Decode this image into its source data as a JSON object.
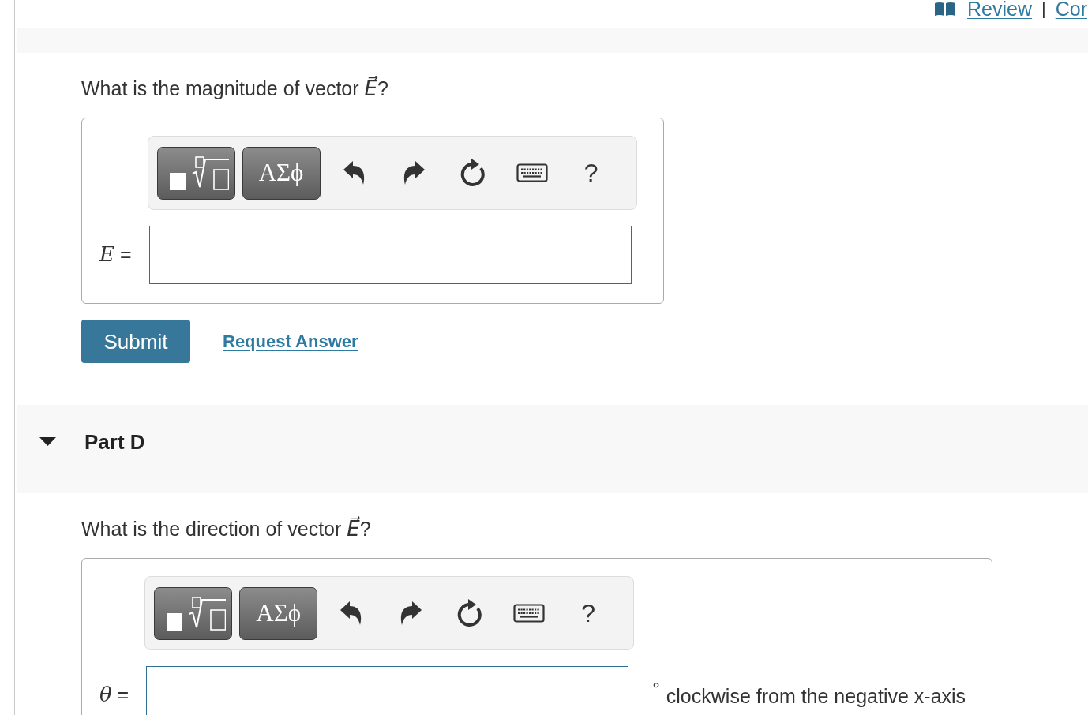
{
  "header": {
    "links": [
      {
        "label": "Review"
      },
      {
        "label": "Cor"
      }
    ],
    "separator": "|"
  },
  "sections": [
    {
      "question": "What is the magnitude of vector *E⃗*?",
      "toolbar": [
        {
          "kind": "templates"
        },
        {
          "kind": "greek",
          "label": "ΑΣϕ"
        },
        {
          "kind": "undo"
        },
        {
          "kind": "redo"
        },
        {
          "kind": "reset"
        },
        {
          "kind": "keyboard"
        },
        {
          "kind": "help",
          "label": "?"
        }
      ],
      "label": "*E* =",
      "actions": {
        "submit": "Submit",
        "request_answer": "Request Answer"
      }
    },
    {
      "heading": "Part D",
      "expanded": true,
      "question": "What is the direction of vector *E⃗*?",
      "toolbar": [
        {
          "kind": "templates"
        },
        {
          "kind": "greek",
          "label": "ΑΣϕ"
        },
        {
          "kind": "undo"
        },
        {
          "kind": "redo"
        },
        {
          "kind": "reset"
        },
        {
          "kind": "keyboard"
        },
        {
          "kind": "help",
          "label": "?"
        }
      ],
      "label": "*θ* =",
      "unit_symbol": "°",
      "unit_text": "clockwise from the negative x-axis"
    }
  ]
}
